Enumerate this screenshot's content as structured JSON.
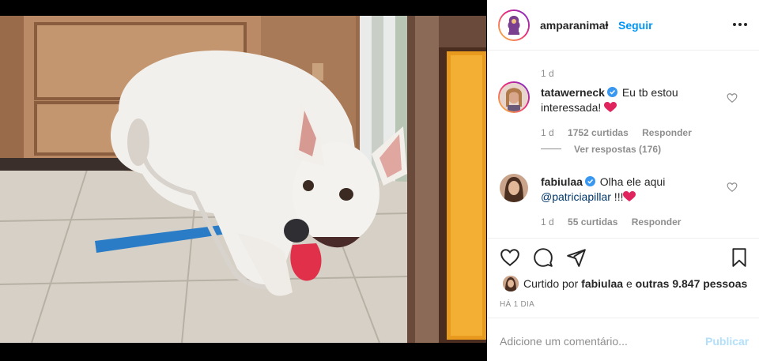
{
  "post": {
    "account": "amparanimal",
    "dot": "•",
    "follow_label": "Seguir",
    "more_icon": "more-horizontal-icon",
    "posted_ago": "1 d"
  },
  "comments": [
    {
      "author": "tatawerneck",
      "verified": true,
      "text": "Eu tb estou interessada!",
      "emoji": "red-heart",
      "time": "1 d",
      "likes": "1752 curtidas",
      "reply_label": "Responder",
      "view_replies": "Ver respostas (176)"
    },
    {
      "author": "fabiulaa",
      "verified": true,
      "text": "Olha ele aqui",
      "mention": "@patriciapillar",
      "text_after": " !!!",
      "emoji": "red-heart",
      "time": "1 d",
      "likes": "55 curtidas",
      "reply_label": "Responder"
    }
  ],
  "actions": {
    "icons": [
      "heart-outline-icon",
      "comment-bubble-icon",
      "share-plane-icon",
      "bookmark-icon"
    ],
    "liked_by_prefix": "Curtido por",
    "liked_by_user": "fabiulaa",
    "liked_by_mid": "e",
    "liked_by_others": "outras 9.847 pessoas",
    "date": "HÁ 1 DIA"
  },
  "composer": {
    "placeholder": "Adicione um comentário...",
    "publish_label": "Publicar"
  },
  "colors": {
    "link_blue": "#0095f6",
    "publish_disabled": "#b2dffc",
    "muted": "#8e8e8e",
    "verified_blue": "#3897f0",
    "heart_red": "#e0245e"
  }
}
